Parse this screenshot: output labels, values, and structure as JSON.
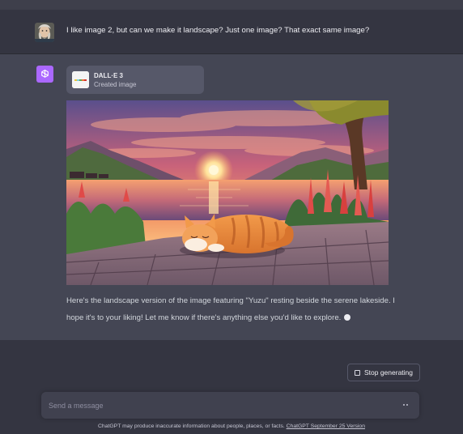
{
  "user_message": {
    "text": "I like image 2, but can we make it landscape? Just one image? That exact same image?"
  },
  "assistant_message": {
    "tool_card": {
      "title": "DALL·E 3",
      "subtitle": "Created image"
    },
    "text": "Here's the landscape version of the image featuring \"Yuzu\" resting beside the serene lakeside. I hope it's to your liking! Let me know if there's anything else you'd like to explore."
  },
  "controls": {
    "stop_label": "Stop generating",
    "input_placeholder": "Send a message"
  },
  "footer": {
    "text": "ChatGPT may produce inaccurate information about people, places, or facts. ",
    "link_text": "ChatGPT September 25 Version"
  },
  "colors": {
    "background": "#343541",
    "assistant_background": "#444654",
    "assistant_avatar": "#ab68ff",
    "input_background": "#40414f"
  },
  "icons": {
    "assistant_avatar": "openai-logo-icon",
    "stop": "stop-square-icon",
    "send": "dots-icon"
  }
}
